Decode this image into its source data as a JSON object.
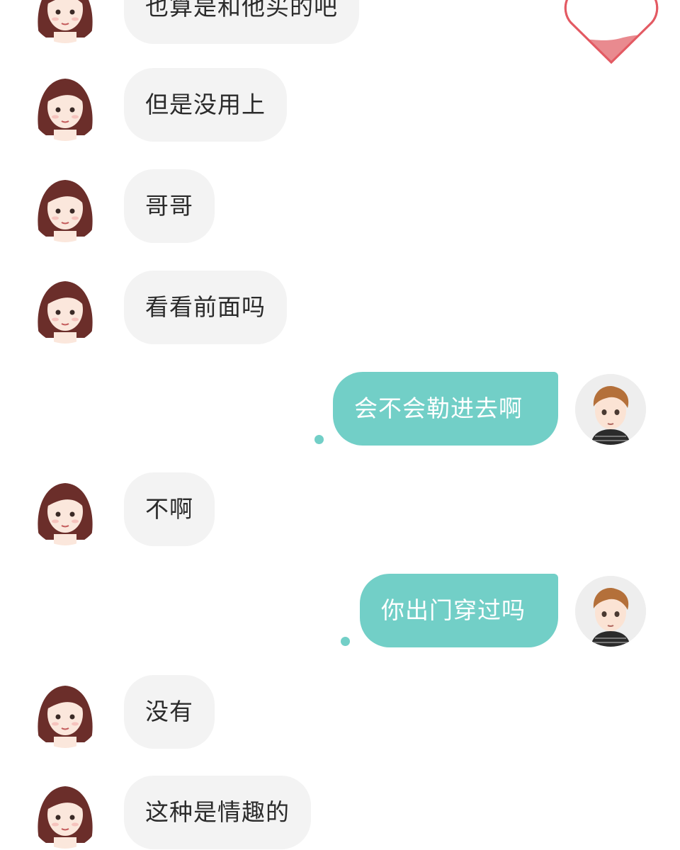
{
  "conversation": {
    "messages": [
      {
        "sender": "her",
        "text": "也算是和他买的吧"
      },
      {
        "sender": "her",
        "text": "但是没用上"
      },
      {
        "sender": "her",
        "text": "哥哥"
      },
      {
        "sender": "her",
        "text": "看看前面吗"
      },
      {
        "sender": "me",
        "text": "会不会勒进去啊"
      },
      {
        "sender": "her",
        "text": "不啊"
      },
      {
        "sender": "me",
        "text": "你出门穿过吗"
      },
      {
        "sender": "her",
        "text": "没有"
      },
      {
        "sender": "her",
        "text": "这种是情趣的"
      }
    ]
  },
  "colors": {
    "incoming_bubble": "#f3f3f3",
    "outgoing_bubble": "#72cfc7",
    "heart_fill": "#e98a8f"
  },
  "icons": {
    "female_avatar": "girl-avatar-icon",
    "male_avatar": "boy-avatar-icon",
    "heart": "heart-icon",
    "status": "read-status-dot"
  }
}
